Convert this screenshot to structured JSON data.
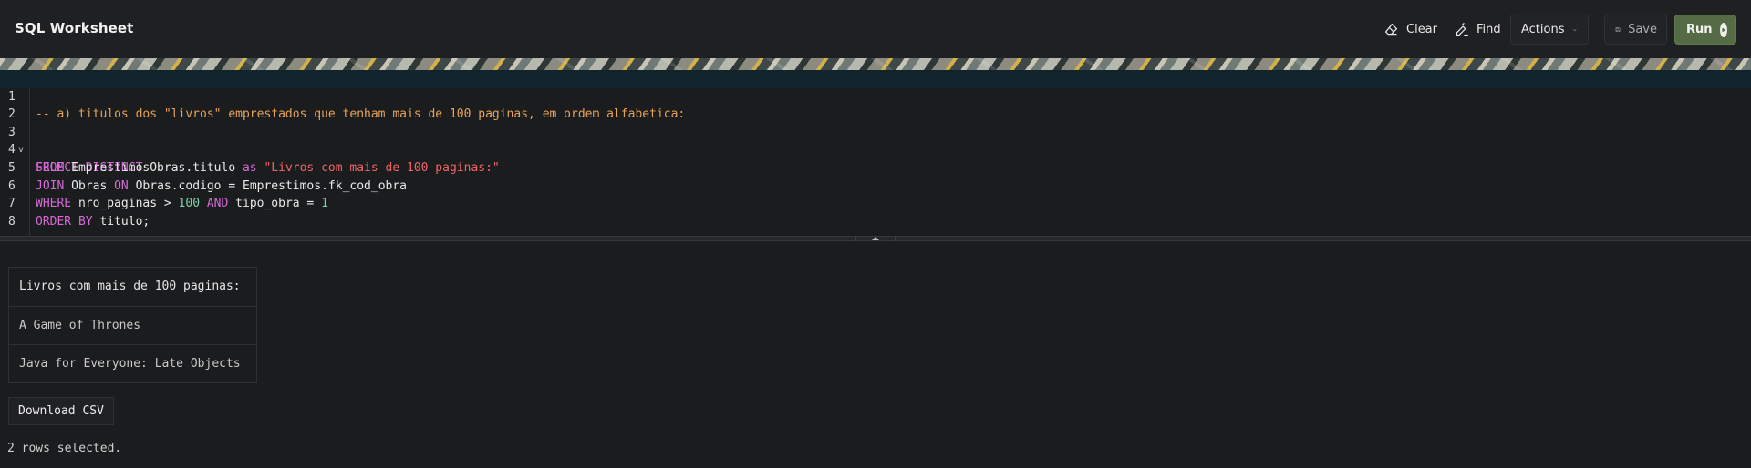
{
  "header": {
    "title": "SQL Worksheet",
    "clear_label": "Clear",
    "find_label": "Find",
    "actions_label": "Actions",
    "save_label": "Save",
    "run_label": "Run"
  },
  "icons": {
    "clear": "eraser-icon",
    "find": "find-replace-icon",
    "actions": "chevron-down-icon",
    "save": "floppy-disk-icon",
    "run": "play-circle-icon"
  },
  "colors": {
    "background": "#1b1c1d",
    "run_button": "#556b46",
    "comment": "#e7a35a",
    "keyword": "#d56ad8",
    "string": "#ef6468",
    "number": "#7fd3a8",
    "active_line": "#10242c"
  },
  "editor": {
    "line_numbers": [
      "1",
      "2",
      "3",
      "4",
      "5",
      "6",
      "7",
      "8"
    ],
    "fold_marker": "v",
    "lines": {
      "l1": "-- a) titulos dos \"livros\" emprestados que tenham mais de 100 paginas, em ordem alfabetica:",
      "l3_kw1": "SELECT DISTINCT",
      "l3_txt1": " Obras.titulo ",
      "l3_kw2": "as",
      "l3_str": " \"Livros com mais de 100 paginas:\"",
      "l4_kw": "FROM",
      "l4_txt": " Emprestimos",
      "l5_kw1": "JOIN",
      "l5_txt1": " Obras ",
      "l5_kw2": "ON",
      "l5_txt2": " Obras.codigo = Emprestimos.fk_cod_obra",
      "l6_kw1": "WHERE",
      "l6_txt1": " nro_paginas > ",
      "l6_num1": "100",
      "l6_kw2": " AND",
      "l6_txt2": " tipo_obra = ",
      "l6_num2": "1",
      "l7_kw": "ORDER BY",
      "l7_txt": " titulo;"
    }
  },
  "results": {
    "header": "Livros com mais de 100 paginas:",
    "rows": [
      "A Game of Thrones",
      "Java for Everyone: Late Objects"
    ],
    "download_label": "Download CSV",
    "status": "2 rows selected."
  }
}
